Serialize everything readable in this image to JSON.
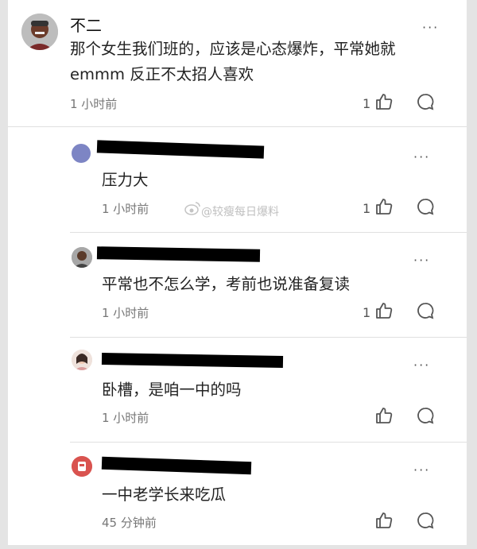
{
  "comments": [
    {
      "name": "不二",
      "text": "那个女生我们班的，应该是心态爆炸，平常她就",
      "text2": "emmm 反正不太招人喜欢",
      "time": "1 小时前",
      "likes": "1"
    },
    {
      "text": "压力大",
      "time": "1 小时前",
      "likes": "1"
    },
    {
      "text": "平常也不怎么学，考前也说准备复读",
      "time": "1 小时前",
      "likes": "1"
    },
    {
      "text": "卧槽，是咱一中的吗",
      "time": "1 小时前"
    },
    {
      "text": "一中老学长来吃瓜",
      "time": "45 分钟前"
    }
  ],
  "more_menu": "···",
  "watermark": "@较瘦每日爆料",
  "colors": {
    "text": "#222222",
    "muted": "#777777",
    "icon": "#555555",
    "divider": "#e0e0e0",
    "redaction": "#000000"
  },
  "icons": [
    "avatar",
    "more-icon",
    "thumbs-up-icon",
    "comment-icon",
    "weibo-icon"
  ]
}
